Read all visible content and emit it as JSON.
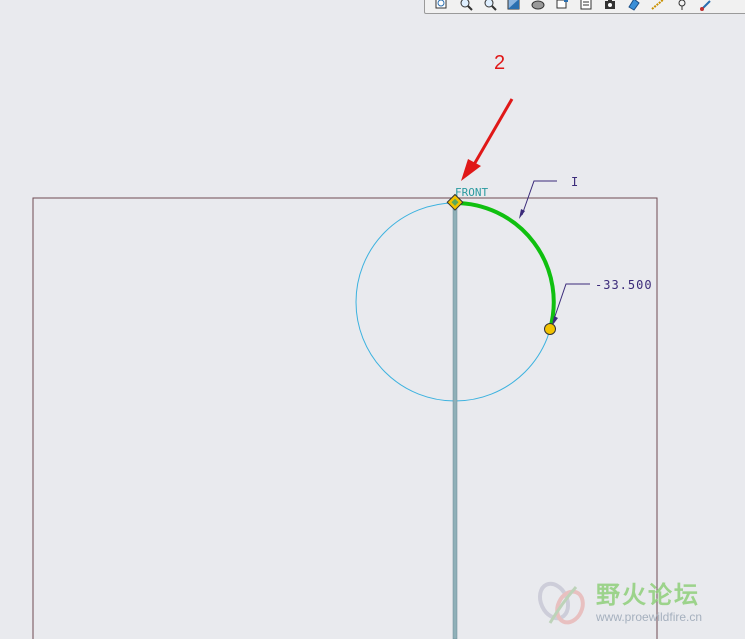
{
  "toolbar": {
    "icons": [
      "zoom-fit-icon",
      "zoom-in-icon",
      "zoom-out-icon",
      "repaint-icon",
      "shading-icon",
      "view-orient-icon",
      "saved-views-icon",
      "layers-icon",
      "datum-planes-icon",
      "datum-axes-icon",
      "datum-points-icon",
      "coordinate-system-icon"
    ]
  },
  "annotation": {
    "number": "2",
    "color": "#e01818"
  },
  "sketch": {
    "datum_label": "FRONT",
    "marker_label": "I",
    "dimension_value": "-33.500",
    "colors": {
      "outline": "#6e4a52",
      "datum": "#2a9aa0",
      "circle": "#3cb2df",
      "arc": "#10c010",
      "dimension": "#3b2b7a",
      "endpoint": "#f2c200"
    }
  },
  "watermark": {
    "title": "野火论坛",
    "url": "www.proewildfire.cn"
  }
}
